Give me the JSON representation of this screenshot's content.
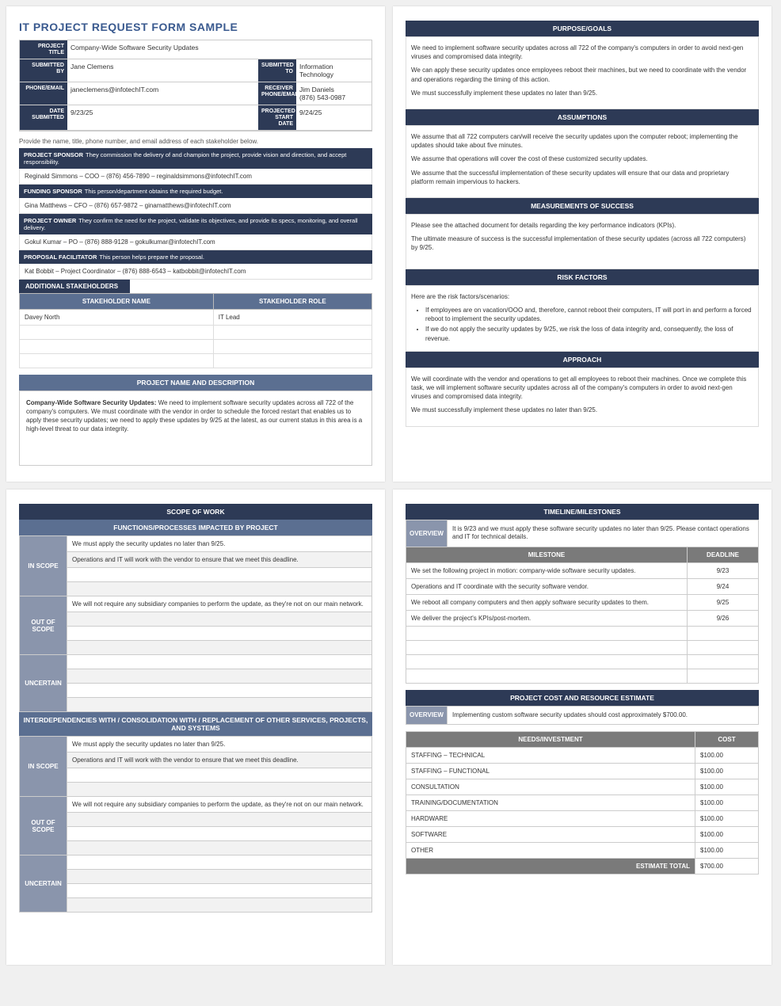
{
  "title": "IT PROJECT REQUEST FORM SAMPLE",
  "form": {
    "projectTitle_lbl": "PROJECT TITLE",
    "projectTitle": "Company-Wide Software Security Updates",
    "submittedBy_lbl": "SUBMITTED BY",
    "submittedBy": "Jane Clemens",
    "submittedTo_lbl": "SUBMITTED TO",
    "submittedTo": "Information Technology",
    "phone_lbl": "PHONE/EMAIL",
    "phone": "janeclemens@infotechIT.com",
    "recv_lbl": "RECEIVER PHONE/EMAIL",
    "recv": "Jim Daniels\n(876) 543-0987",
    "date_lbl": "DATE SUBMITTED",
    "date": "9/23/25",
    "proj_lbl": "PROJECTED START DATE",
    "proj": "9/24/25"
  },
  "stakeNote": "Provide the name, title, phone number, and email address of each stakeholder below.",
  "sponsor": {
    "role": "PROJECT SPONSOR",
    "desc": "They commission the delivery of and champion the project, provide vision and direction, and accept responsibility.",
    "val": "Reginald Simmons – COO – (876) 456-7890 – reginaldsimmons@infotechIT.com"
  },
  "funding": {
    "role": "FUNDING SPONSOR",
    "desc": "This person/department obtains the required budget.",
    "val": "Gina Matthews – CFO – (876) 657-9872 – ginamatthews@infotechIT.com"
  },
  "owner": {
    "role": "PROJECT OWNER",
    "desc": "They confirm the need for the project, validate its objectives, and provide its specs, monitoring, and overall delivery.",
    "val": "Gokul Kumar – PO – (876) 888-9128 – gokulkumar@infotechIT.com"
  },
  "facil": {
    "role": "PROPOSAL FACILITATOR",
    "desc": "This person helps prepare the proposal.",
    "val": "Kat Bobbit – Project Coordinator – (876) 888-6543 – katbobbit@infotechIT.com"
  },
  "addlHdr": "ADDITIONAL STAKEHOLDERS",
  "shCols": {
    "name": "STAKEHOLDER NAME",
    "role": "STAKEHOLDER ROLE"
  },
  "sh": [
    {
      "name": "Davey North",
      "role": "IT Lead"
    },
    {
      "name": "",
      "role": ""
    },
    {
      "name": "",
      "role": ""
    },
    {
      "name": "",
      "role": ""
    }
  ],
  "pnd": {
    "hdr": "PROJECT NAME AND DESCRIPTION",
    "bold": "Company-Wide Software Security Updates:",
    "text": " We need to implement software security updates across all 722 of the company's computers. We must coordinate with the vendor in order to schedule the forced restart that enables us to apply these security updates; we need to apply these updates by 9/25 at the latest, as our current status in this area is a high-level threat to our data integrity."
  },
  "purpose": {
    "hdr": "PURPOSE/GOALS",
    "p": [
      "We need to implement software security updates across all 722 of the company's computers in order to avoid next-gen viruses and compromised data integrity.",
      "We can apply these security updates once employees reboot their machines, but we need to coordinate with the vendor and operations regarding the timing of this action.",
      "We must successfully implement these updates no later than 9/25."
    ]
  },
  "assume": {
    "hdr": "ASSUMPTIONS",
    "p": [
      "We assume that all 722 computers can/will receive the security updates upon the computer reboot; implementing the updates should take about five minutes.",
      "We assume that operations will cover the cost of these customized security updates.",
      "We assume that the successful implementation of these security updates will ensure that our data and proprietary platform remain impervious to hackers."
    ]
  },
  "measure": {
    "hdr": "MEASUREMENTS OF SUCCESS",
    "p": [
      "Please see the attached document for details regarding the key performance indicators (KPIs).",
      "The ultimate measure of success is the successful implementation of these security updates (across all 722 computers) by 9/25."
    ]
  },
  "risk": {
    "hdr": "RISK FACTORS",
    "lead": "Here are the risk factors/scenarios:",
    "items": [
      "If employees are on vacation/OOO and, therefore, cannot reboot their computers, IT will port in and perform a forced reboot to implement the security updates.",
      "If we do not apply the security updates by 9/25, we risk the loss of data integrity and, consequently, the loss of revenue."
    ]
  },
  "approach": {
    "hdr": "APPROACH",
    "p": [
      "We will coordinate with the vendor and operations to get all employees to reboot their machines. Once we complete this task, we will implement software security updates across all of the company's computers in order to avoid next-gen viruses and compromised data integrity.",
      "We must successfully implement these updates no later than 9/25."
    ]
  },
  "scope": {
    "hdr": "SCOPE OF WORK",
    "sub": "FUNCTIONS/PROCESSES IMPACTED BY PROJECT",
    "inLbl": "IN SCOPE",
    "outLbl": "OUT OF SCOPE",
    "uncLbl": "UNCERTAIN",
    "in": [
      "We must apply the security updates no later than 9/25.",
      "Operations and IT will work with the vendor to ensure that we meet this deadline.",
      "",
      ""
    ],
    "out": [
      "We will not require any subsidiary companies to perform the update, as they're not on our main network.",
      "",
      "",
      ""
    ],
    "unc": [
      "",
      "",
      "",
      ""
    ],
    "inter": "INTERDEPENDENCIES WITH / CONSOLIDATION WITH / REPLACEMENT OF OTHER SERVICES, PROJECTS, AND SYSTEMS"
  },
  "tm": {
    "hdr": "TIMELINE/MILESTONES",
    "ovLbl": "OVERVIEW",
    "ov": "It is 9/23 and we must apply these software security updates no later than 9/25. Please contact operations and IT for technical details.",
    "mCol": "MILESTONE",
    "dCol": "DEADLINE",
    "rows": [
      {
        "m": "We set the following project in motion: company-wide software security updates.",
        "d": "9/23"
      },
      {
        "m": "Operations and IT coordinate with the security software vendor.",
        "d": "9/24"
      },
      {
        "m": "We reboot all company computers and then apply software security updates to them.",
        "d": "9/25"
      },
      {
        "m": "We deliver the project's KPIs/post-mortem.",
        "d": "9/26"
      },
      {
        "m": "",
        "d": ""
      },
      {
        "m": "",
        "d": ""
      },
      {
        "m": "",
        "d": ""
      },
      {
        "m": "",
        "d": ""
      }
    ]
  },
  "cost": {
    "hdr": "PROJECT COST AND RESOURCE ESTIMATE",
    "ovLbl": "OVERVIEW",
    "ov": "Implementing custom software security updates should cost approximately $700.00.",
    "nCol": "NEEDS/INVESTMENT",
    "cCol": "COST",
    "rows": [
      {
        "n": "STAFFING – TECHNICAL",
        "c": "$100.00"
      },
      {
        "n": "STAFFING – FUNCTIONAL",
        "c": "$100.00"
      },
      {
        "n": "CONSULTATION",
        "c": "$100.00"
      },
      {
        "n": "TRAINING/DOCUMENTATION",
        "c": "$100.00"
      },
      {
        "n": "HARDWARE",
        "c": "$100.00"
      },
      {
        "n": "SOFTWARE",
        "c": "$100.00"
      },
      {
        "n": "OTHER",
        "c": "$100.00"
      }
    ],
    "totLbl": "ESTIMATE TOTAL",
    "tot": "$700.00"
  }
}
